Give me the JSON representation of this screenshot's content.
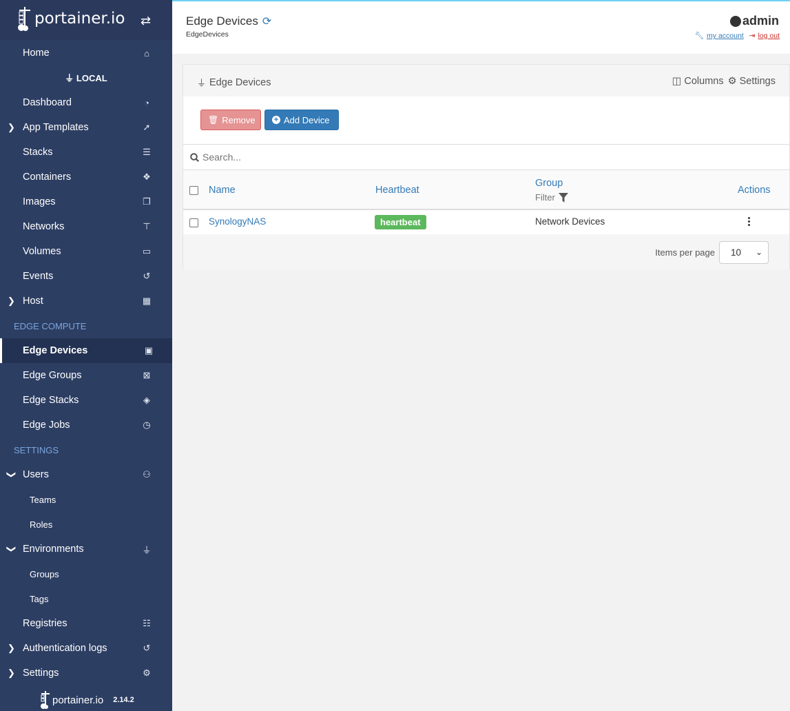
{
  "brand": {
    "name": "portainer.io",
    "version": "2.14.2"
  },
  "sidebar": {
    "home": "Home",
    "environment": "LOCAL",
    "items": [
      {
        "label": "Dashboard"
      },
      {
        "label": "App Templates"
      },
      {
        "label": "Stacks"
      },
      {
        "label": "Containers"
      },
      {
        "label": "Images"
      },
      {
        "label": "Networks"
      },
      {
        "label": "Volumes"
      },
      {
        "label": "Events"
      },
      {
        "label": "Host"
      }
    ],
    "edge_heading": "EDGE COMPUTE",
    "edge_items": [
      {
        "label": "Edge Devices"
      },
      {
        "label": "Edge Groups"
      },
      {
        "label": "Edge Stacks"
      },
      {
        "label": "Edge Jobs"
      }
    ],
    "settings_heading": "SETTINGS",
    "settings_items": [
      {
        "label": "Users"
      },
      {
        "label": "Teams"
      },
      {
        "label": "Roles"
      },
      {
        "label": "Environments"
      },
      {
        "label": "Groups"
      },
      {
        "label": "Tags"
      },
      {
        "label": "Registries"
      },
      {
        "label": "Authentication logs"
      },
      {
        "label": "Settings"
      }
    ],
    "active": "Edge Devices"
  },
  "header": {
    "title": "Edge Devices",
    "breadcrumb": "EdgeDevices",
    "username": "admin",
    "my_account": "my account",
    "log_out": "log out"
  },
  "panel": {
    "title": "Edge Devices",
    "columns_label": "Columns",
    "settings_label": "Settings",
    "remove_label": "Remove",
    "add_label": "Add Device",
    "search_placeholder": "Search...",
    "headers": {
      "name": "Name",
      "heartbeat": "Heartbeat",
      "group": "Group",
      "filter": "Filter",
      "actions": "Actions"
    },
    "rows": [
      {
        "name": "SynologyNAS",
        "heartbeat": "heartbeat",
        "group": "Network Devices"
      }
    ],
    "items_per_page_label": "Items per page",
    "items_per_page": "10"
  },
  "colors": {
    "sidebar_bg": "#2d3e63",
    "accent": "#337ab7",
    "heartbeat_ok": "#5cb85c",
    "remove": "#d9534f"
  }
}
